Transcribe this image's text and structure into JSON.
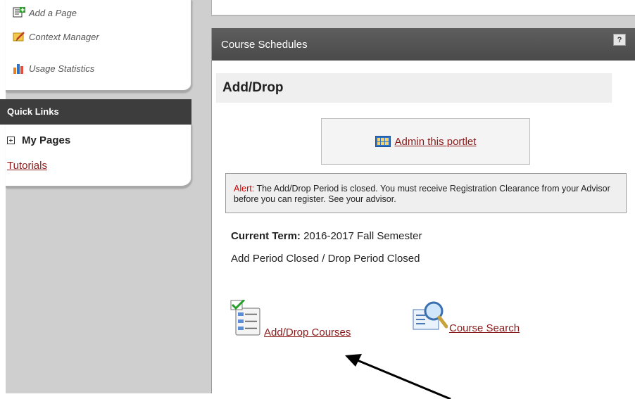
{
  "sidebar": {
    "admin_items": [
      {
        "label": "Add a Page",
        "icon": "add-page-icon"
      },
      {
        "label": "Context Manager",
        "icon": "pencil-note-icon"
      },
      {
        "label": "Usage Statistics",
        "icon": "bar-chart-icon"
      }
    ],
    "quick_links": {
      "title": "Quick Links",
      "my_pages": "My Pages",
      "tutorials": "Tutorials"
    }
  },
  "portlet": {
    "title": "Course Schedules",
    "help_label": "?",
    "section_title": "Add/Drop",
    "admin_link": "Admin this portlet",
    "alert": {
      "label": "Alert:",
      "message": "The Add/Drop Period is closed. You must receive Registration Clearance from your Advisor before you can register. See your advisor."
    },
    "current_term_label": "Current Term:",
    "current_term_value": "2016-2017 Fall Semester",
    "period_status": "Add Period Closed / Drop Period Closed",
    "actions": [
      {
        "label": "Add/Drop Courses",
        "icon": "checklist-form-icon"
      },
      {
        "label": "Course Search",
        "icon": "magnifier-document-icon"
      }
    ]
  },
  "colors": {
    "link": "#8a1a1a",
    "header_dark": "#3d3d3d",
    "alert_red": "#d40000",
    "page_gray": "#cfcfcf"
  }
}
